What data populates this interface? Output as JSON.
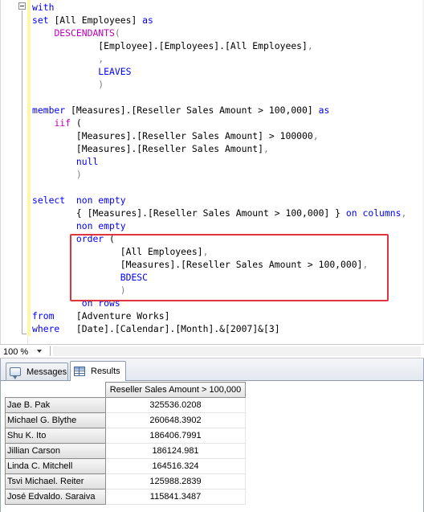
{
  "editor": {
    "lines": [
      [
        {
          "t": "with",
          "c": "kw"
        }
      ],
      [
        {
          "t": "set ",
          "c": "kw"
        },
        {
          "t": "[All Employees] "
        },
        {
          "t": "as",
          "c": "kw"
        }
      ],
      [
        {
          "t": "    "
        },
        {
          "t": "DESCENDANTS",
          "c": "fn"
        },
        {
          "t": "(",
          "c": "op"
        }
      ],
      [
        {
          "t": "            [Employee].[Employees].[All Employees]"
        },
        {
          "t": ",",
          "c": "op"
        }
      ],
      [
        {
          "t": "            "
        },
        {
          "t": ",",
          "c": "op"
        }
      ],
      [
        {
          "t": "            "
        },
        {
          "t": "LEAVES",
          "c": "kw"
        }
      ],
      [
        {
          "t": "            "
        },
        {
          "t": ")",
          "c": "op"
        }
      ],
      [
        {
          "t": ""
        }
      ],
      [
        {
          "t": "member ",
          "c": "kw"
        },
        {
          "t": "[Measures].[Reseller Sales Amount > 100,000] "
        },
        {
          "t": "as",
          "c": "kw"
        }
      ],
      [
        {
          "t": "    "
        },
        {
          "t": "iif",
          "c": "fn"
        },
        {
          "t": " ("
        }
      ],
      [
        {
          "t": "        [Measures].[Reseller Sales Amount] > 100000"
        },
        {
          "t": ",",
          "c": "op"
        }
      ],
      [
        {
          "t": "        [Measures].[Reseller Sales Amount]"
        },
        {
          "t": ",",
          "c": "op"
        }
      ],
      [
        {
          "t": "        "
        },
        {
          "t": "null",
          "c": "kw"
        }
      ],
      [
        {
          "t": "        "
        },
        {
          "t": ")",
          "c": "op"
        }
      ],
      [
        {
          "t": ""
        }
      ],
      [
        {
          "t": "select  ",
          "c": "kw"
        },
        {
          "t": "non empty",
          "c": "kw"
        }
      ],
      [
        {
          "t": "        { [Measures].[Reseller Sales Amount > 100,000] } "
        },
        {
          "t": "on columns",
          "c": "kw"
        },
        {
          "t": ",",
          "c": "op"
        }
      ],
      [
        {
          "t": "        "
        },
        {
          "t": "non empty",
          "c": "kw"
        }
      ],
      [
        {
          "t": "        "
        },
        {
          "t": "order",
          "c": "kw"
        },
        {
          "t": " ("
        }
      ],
      [
        {
          "t": "                [All Employees]"
        },
        {
          "t": ",",
          "c": "op"
        }
      ],
      [
        {
          "t": "                [Measures].[Reseller Sales Amount > 100,000]"
        },
        {
          "t": ",",
          "c": "op"
        }
      ],
      [
        {
          "t": "                "
        },
        {
          "t": "BDESC",
          "c": "kw"
        }
      ],
      [
        {
          "t": "                "
        },
        {
          "t": ")",
          "c": "op"
        }
      ],
      [
        {
          "t": "         "
        },
        {
          "t": "on rows",
          "c": "kw"
        }
      ],
      [
        {
          "t": "from    ",
          "c": "kw"
        },
        {
          "t": "[Adventure Works]"
        }
      ],
      [
        {
          "t": "where   ",
          "c": "kw"
        },
        {
          "t": "[Date].[Calendar].[Month].&[2007]&[3]"
        }
      ]
    ]
  },
  "zoom": {
    "value": "100 %"
  },
  "tabs": {
    "messages": "Messages",
    "results": "Results"
  },
  "grid": {
    "column_header": "Reseller Sales Amount > 100,000",
    "rows": [
      {
        "name": "Jae B. Pak",
        "value": "325536.0208"
      },
      {
        "name": "Michael G. Blythe",
        "value": "260648.3902"
      },
      {
        "name": "Shu K. Ito",
        "value": "186406.7991"
      },
      {
        "name": "Jillian Carson",
        "value": "186124.981"
      },
      {
        "name": "Linda C. Mitchell",
        "value": "164516.324"
      },
      {
        "name": "Tsvi Michael. Reiter",
        "value": "125988.2839"
      },
      {
        "name": "José Edvaldo. Saraiva",
        "value": "115841.3487"
      }
    ]
  },
  "colors": {
    "keyword": "#0000ff",
    "function": "#c000c0",
    "highlight_box": "#e0343f"
  }
}
